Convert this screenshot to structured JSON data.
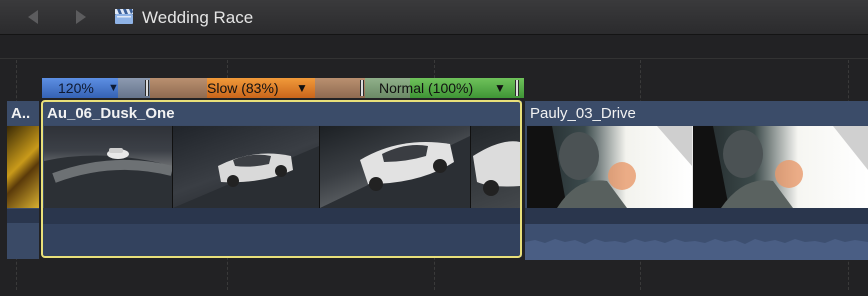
{
  "titlebar": {
    "project_title": "Wedding Race",
    "back_icon": "chevron-left-icon",
    "forward_icon": "chevron-right-icon",
    "project_icon": "clapperboard-icon"
  },
  "retime": {
    "segments": [
      {
        "label": "120%",
        "color": "#4a7bd0",
        "arrow": "▼"
      },
      {
        "label": "Slow (83%)",
        "color": "#e07f2a",
        "arrow": "▼"
      },
      {
        "label": "Normal (100%)",
        "color": "#58ae48",
        "arrow": "▼"
      }
    ]
  },
  "clips": {
    "partial_clip_label": "A..",
    "main_clip_label": "Au_06_Dusk_One",
    "next_clip_label": "Pauly_03_Drive"
  },
  "colors": {
    "selection_outline": "#e9e07a",
    "clip_body": "#3a4a66"
  }
}
